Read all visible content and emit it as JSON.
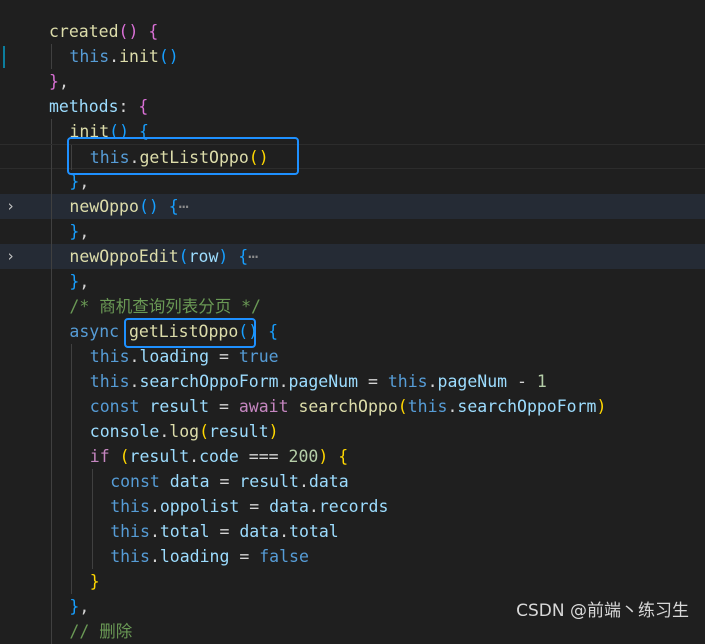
{
  "watermark": "CSDN @前端丶练习生",
  "fold_ellipsis": "⋯",
  "lines": [
    [
      {
        "t": "created",
        "c": "fn"
      },
      {
        "t": "()",
        "c": "br2"
      },
      {
        "t": " ",
        "c": "pun"
      },
      {
        "t": "{",
        "c": "br2"
      }
    ],
    [
      {
        "t": "this",
        "c": "kw"
      },
      {
        "t": ".",
        "c": "pun"
      },
      {
        "t": "init",
        "c": "fn"
      },
      {
        "t": "()",
        "c": "br3"
      }
    ],
    [
      {
        "t": "}",
        "c": "br2"
      },
      {
        "t": ",",
        "c": "pun"
      }
    ],
    [
      {
        "t": "methods",
        "c": "var"
      },
      {
        "t": ": ",
        "c": "pun"
      },
      {
        "t": "{",
        "c": "br2"
      }
    ],
    [
      {
        "t": "init",
        "c": "fn"
      },
      {
        "t": "()",
        "c": "br3"
      },
      {
        "t": " ",
        "c": "pun"
      },
      {
        "t": "{",
        "c": "br3"
      }
    ],
    [
      {
        "t": "this",
        "c": "kw"
      },
      {
        "t": ".",
        "c": "pun"
      },
      {
        "t": "getListOppo",
        "c": "fn"
      },
      {
        "t": "()",
        "c": "br1"
      }
    ],
    [
      {
        "t": "}",
        "c": "br3"
      },
      {
        "t": ",",
        "c": "pun"
      }
    ],
    [
      {
        "t": "newOppo",
        "c": "fn"
      },
      {
        "t": "()",
        "c": "br3"
      },
      {
        "t": " ",
        "c": "pun"
      },
      {
        "t": "{",
        "c": "br3"
      },
      {
        "t": "⋯",
        "c": "ell"
      }
    ],
    [
      {
        "t": "}",
        "c": "br3"
      },
      {
        "t": ",",
        "c": "pun"
      }
    ],
    [
      {
        "t": "newOppoEdit",
        "c": "fn"
      },
      {
        "t": "(",
        "c": "br3"
      },
      {
        "t": "row",
        "c": "var"
      },
      {
        "t": ")",
        "c": "br3"
      },
      {
        "t": " ",
        "c": "pun"
      },
      {
        "t": "{",
        "c": "br3"
      },
      {
        "t": "⋯",
        "c": "ell"
      }
    ],
    [
      {
        "t": "}",
        "c": "br3"
      },
      {
        "t": ",",
        "c": "pun"
      }
    ],
    [
      {
        "t": "/* 商机查询列表分页 */",
        "c": "cm"
      }
    ],
    [
      {
        "t": "async",
        "c": "kw"
      },
      {
        "t": " ",
        "c": "pun"
      },
      {
        "t": "getListOppo",
        "c": "fn"
      },
      {
        "t": "()",
        "c": "br3"
      },
      {
        "t": " ",
        "c": "pun"
      },
      {
        "t": "{",
        "c": "br3"
      }
    ],
    [
      {
        "t": "this",
        "c": "kw"
      },
      {
        "t": ".",
        "c": "pun"
      },
      {
        "t": "loading",
        "c": "var"
      },
      {
        "t": " = ",
        "c": "pun"
      },
      {
        "t": "true",
        "c": "kw"
      }
    ],
    [
      {
        "t": "this",
        "c": "kw"
      },
      {
        "t": ".",
        "c": "pun"
      },
      {
        "t": "searchOppoForm",
        "c": "var"
      },
      {
        "t": ".",
        "c": "pun"
      },
      {
        "t": "pageNum",
        "c": "var"
      },
      {
        "t": " = ",
        "c": "pun"
      },
      {
        "t": "this",
        "c": "kw"
      },
      {
        "t": ".",
        "c": "pun"
      },
      {
        "t": "pageNum",
        "c": "var"
      },
      {
        "t": " - ",
        "c": "pun"
      },
      {
        "t": "1",
        "c": "num"
      }
    ],
    [
      {
        "t": "const",
        "c": "kw"
      },
      {
        "t": " ",
        "c": "pun"
      },
      {
        "t": "result",
        "c": "var"
      },
      {
        "t": " = ",
        "c": "pun"
      },
      {
        "t": "await",
        "c": "ctrl"
      },
      {
        "t": " ",
        "c": "pun"
      },
      {
        "t": "searchOppo",
        "c": "fn"
      },
      {
        "t": "(",
        "c": "br1"
      },
      {
        "t": "this",
        "c": "kw"
      },
      {
        "t": ".",
        "c": "pun"
      },
      {
        "t": "searchOppoForm",
        "c": "var"
      },
      {
        "t": ")",
        "c": "br1"
      }
    ],
    [
      {
        "t": "console",
        "c": "var"
      },
      {
        "t": ".",
        "c": "pun"
      },
      {
        "t": "log",
        "c": "fn"
      },
      {
        "t": "(",
        "c": "br1"
      },
      {
        "t": "result",
        "c": "var"
      },
      {
        "t": ")",
        "c": "br1"
      }
    ],
    [
      {
        "t": "if",
        "c": "ctrl"
      },
      {
        "t": " ",
        "c": "pun"
      },
      {
        "t": "(",
        "c": "br1"
      },
      {
        "t": "result",
        "c": "var"
      },
      {
        "t": ".",
        "c": "pun"
      },
      {
        "t": "code",
        "c": "var"
      },
      {
        "t": " === ",
        "c": "pun"
      },
      {
        "t": "200",
        "c": "num"
      },
      {
        "t": ")",
        "c": "br1"
      },
      {
        "t": " ",
        "c": "pun"
      },
      {
        "t": "{",
        "c": "br1"
      }
    ],
    [
      {
        "t": "const",
        "c": "kw"
      },
      {
        "t": " ",
        "c": "pun"
      },
      {
        "t": "data",
        "c": "var"
      },
      {
        "t": " = ",
        "c": "pun"
      },
      {
        "t": "result",
        "c": "var"
      },
      {
        "t": ".",
        "c": "pun"
      },
      {
        "t": "data",
        "c": "var"
      }
    ],
    [
      {
        "t": "this",
        "c": "kw"
      },
      {
        "t": ".",
        "c": "pun"
      },
      {
        "t": "oppolist",
        "c": "var"
      },
      {
        "t": " = ",
        "c": "pun"
      },
      {
        "t": "data",
        "c": "var"
      },
      {
        "t": ".",
        "c": "pun"
      },
      {
        "t": "records",
        "c": "var"
      }
    ],
    [
      {
        "t": "this",
        "c": "kw"
      },
      {
        "t": ".",
        "c": "pun"
      },
      {
        "t": "total",
        "c": "var"
      },
      {
        "t": " = ",
        "c": "pun"
      },
      {
        "t": "data",
        "c": "var"
      },
      {
        "t": ".",
        "c": "pun"
      },
      {
        "t": "total",
        "c": "var"
      }
    ],
    [
      {
        "t": "this",
        "c": "kw"
      },
      {
        "t": ".",
        "c": "pun"
      },
      {
        "t": "loading",
        "c": "var"
      },
      {
        "t": " = ",
        "c": "pun"
      },
      {
        "t": "false",
        "c": "kw"
      }
    ],
    [
      {
        "t": "}",
        "c": "br1"
      }
    ],
    [
      {
        "t": "}",
        "c": "br3"
      },
      {
        "t": ",",
        "c": "pun"
      }
    ],
    [
      {
        "t": "// 删除",
        "c": "cm"
      }
    ]
  ]
}
